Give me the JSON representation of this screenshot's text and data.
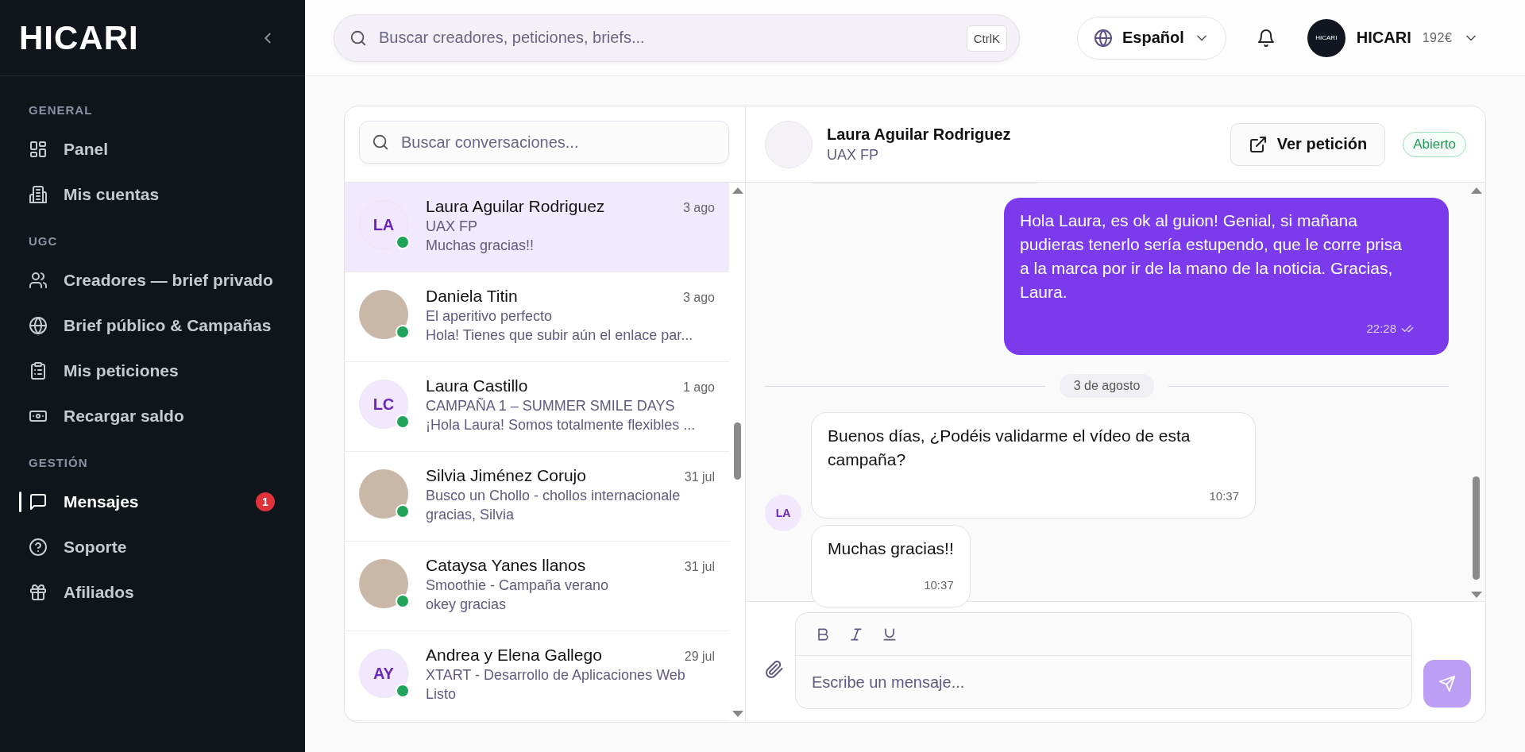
{
  "sidebar": {
    "logo": "HICARI",
    "sections": [
      {
        "heading": "GENERAL",
        "items": [
          {
            "label": "Panel",
            "selected": false
          },
          {
            "label": "Mis cuentas",
            "selected": false
          }
        ]
      },
      {
        "heading": "UGC",
        "items": [
          {
            "label": "Creadores — brief privado",
            "selected": false
          },
          {
            "label": "Brief público & Campañas",
            "selected": false
          },
          {
            "label": "Mis peticiones",
            "selected": false
          },
          {
            "label": "Recargar saldo",
            "selected": false
          }
        ]
      },
      {
        "heading": "GESTIÓN",
        "items": [
          {
            "label": "Mensajes",
            "selected": true,
            "badge": "1"
          },
          {
            "label": "Soporte",
            "selected": false
          },
          {
            "label": "Afiliados",
            "selected": false
          }
        ]
      }
    ]
  },
  "topbar": {
    "search": {
      "placeholder": "Buscar creadores, peticiones, briefs...",
      "shortcut": "CtrlK"
    },
    "language": "Español",
    "user": {
      "avatar_text": "HICARI",
      "name": "HICARI",
      "balance": "192€"
    }
  },
  "conversations": {
    "search": {
      "placeholder": "Buscar conversaciones..."
    },
    "items": [
      {
        "name": "Laura Aguilar Rodriguez",
        "time": "3 ago",
        "subject": "UAX FP",
        "preview": "Muchas gracias!!",
        "avatar": {
          "kind": "initials",
          "text": "LA"
        },
        "online": true,
        "selected": true
      },
      {
        "name": "Daniela Titin",
        "time": "3 ago",
        "subject": "El aperitivo perfecto",
        "preview": "Hola! Tienes que subir aún el enlace par...",
        "avatar": {
          "kind": "photo"
        },
        "online": true,
        "selected": false
      },
      {
        "name": "Laura Castillo",
        "time": "1 ago",
        "subject": "CAMPAÑA 1 – SUMMER SMILE DAYS",
        "preview": "¡Hola Laura! Somos totalmente flexibles ...",
        "avatar": {
          "kind": "initials",
          "text": "LC"
        },
        "online": true,
        "selected": false
      },
      {
        "name": "Silvia Jiménez Corujo",
        "time": "31 jul",
        "subject": "Busco un Chollo - chollos internacionale",
        "preview": "gracias, Silvia",
        "avatar": {
          "kind": "photo"
        },
        "online": true,
        "selected": false
      },
      {
        "name": "Cataysa Yanes llanos",
        "time": "31 jul",
        "subject": "Smoothie - Campaña verano",
        "preview": "okey gracias",
        "avatar": {
          "kind": "photo"
        },
        "online": true,
        "selected": false
      },
      {
        "name": "Andrea y Elena Gallego",
        "time": "29 jul",
        "subject": "XTART - Desarrollo de Aplicaciones Web",
        "preview": "Listo",
        "avatar": {
          "kind": "initials",
          "text": "AY"
        },
        "online": true,
        "selected": false
      }
    ]
  },
  "chat": {
    "header": {
      "name": "Laura Aguilar Rodriguez",
      "subtitle": "UAX FP",
      "action": "Ver petición",
      "status": "Abierto"
    },
    "messages": [
      {
        "kind": "outgoing",
        "text": "Hola Laura, es ok al guion! Genial, si mañana pudieras tenerlo sería estupendo, que le corre prisa a la marca por ir de la mano de la noticia. Gracias, Laura.",
        "time": "22:28",
        "read": true
      },
      {
        "kind": "date",
        "text": "3 de agosto"
      },
      {
        "kind": "incoming",
        "avatar": "LA",
        "bubbles": [
          {
            "text": "Buenos días, ¿Podéis validarme el vídeo de esta campaña?",
            "time": "10:37"
          },
          {
            "text": "Muchas gracias!!",
            "time": "10:37"
          }
        ]
      }
    ],
    "composer": {
      "placeholder": "Escribe un mensaje...",
      "send_disabled": true
    }
  }
}
